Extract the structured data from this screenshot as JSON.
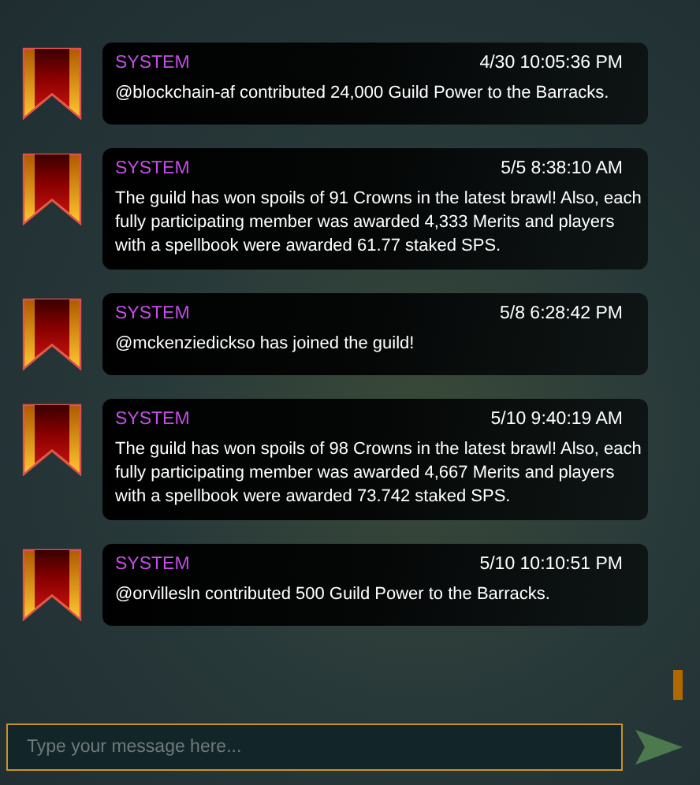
{
  "messages": [
    {
      "sender": "SYSTEM",
      "time": "4/30 10:05:36 PM",
      "text": "@blockchain-af contributed 24,000 Guild Power to the Barracks."
    },
    {
      "sender": "SYSTEM",
      "time": "5/5 8:38:10 AM",
      "text": "The guild has won spoils of 91 Crowns in the latest brawl! Also, each fully participating member was awarded 4,333 Merits and players with a spellbook were awarded 61.77 staked SPS."
    },
    {
      "sender": "SYSTEM",
      "time": "5/8 6:28:42 PM",
      "text": "@mckenziedickso has joined the guild!"
    },
    {
      "sender": "SYSTEM",
      "time": "5/10 9:40:19 AM",
      "text": "The guild has won spoils of 98 Crowns in the latest brawl! Also, each fully participating member was awarded 4,667 Merits and players with a spellbook were awarded 73.742 staked SPS."
    },
    {
      "sender": "SYSTEM",
      "time": "5/10 10:10:51 PM",
      "text": "@orvillesln contributed 500 Guild Power to the Barracks."
    }
  ],
  "composer": {
    "placeholder": "Type your message here..."
  }
}
